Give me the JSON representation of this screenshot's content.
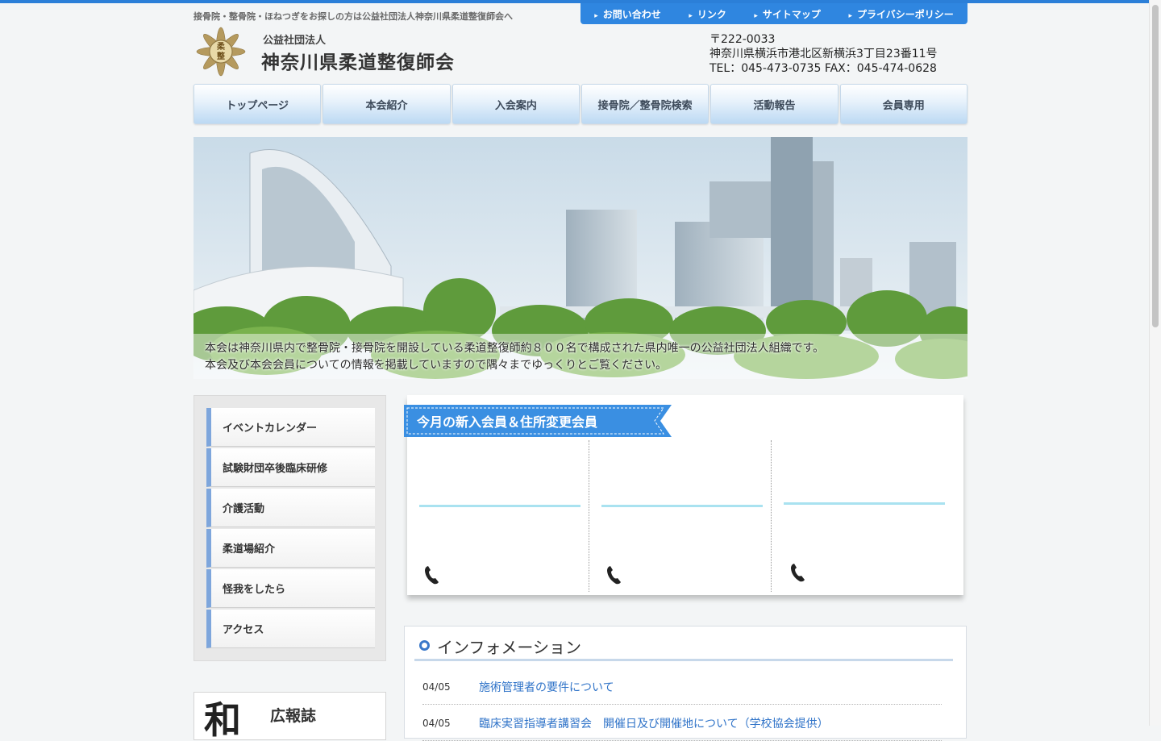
{
  "header": {
    "tagline": "接骨院・整骨院・ほねつぎをお探しの方は公益社団法人神奈川県柔道整復師会へ",
    "org_sub": "公益社団法人",
    "org_name": "神奈川県柔道整復師会",
    "logo_glyph": "柔整",
    "postal": "〒222-0033",
    "address": "神奈川県横浜市港北区新横浜3丁目23番11号",
    "tel_fax": "TEL：045-473-0735  FAX：045-474-0628"
  },
  "util_nav": [
    "お問い合わせ",
    "リンク",
    "サイトマップ",
    "プライバシーポリシー"
  ],
  "global_nav": [
    "トップページ",
    "本会紹介",
    "入会案内",
    "接骨院／整骨院検索",
    "活動報告",
    "会員専用"
  ],
  "hero": {
    "line1": "本会は神奈川県内で整骨院・接骨院を開設している柔道整復師約８００名で構成された県内唯一の公益社団法人組織です。",
    "line2": "本会及び本会会員についての情報を掲載していますので隅々までゆっくりとご覧ください。"
  },
  "side_nav": [
    "イベントカレンダー",
    "試験財団卒後臨床研修",
    "介護活動",
    "柔道場紹介",
    "怪我をしたら",
    "アクセス"
  ],
  "koho": {
    "char": "和",
    "label": "広報誌"
  },
  "members": {
    "title": "今月の新入会員＆住所変更会員"
  },
  "info": {
    "title": "インフォメーション",
    "items": [
      {
        "date": "04/05",
        "text": "施術管理者の要件について"
      },
      {
        "date": "04/05",
        "text": "臨床実習指導者講習会　開催日及び開催地について（学校協会提供）"
      }
    ]
  },
  "colors": {
    "accent": "#2f86e0",
    "nav_gradient_bottom": "#bcd9f3",
    "side_nav_bar": "#7ea6dc",
    "link": "#2f73c8",
    "member_line": "#a9e2f0"
  },
  "icons": [
    "arrow-right-icon",
    "phone-icon",
    "circle-bullet-icon",
    "logo-emblem-icon"
  ]
}
